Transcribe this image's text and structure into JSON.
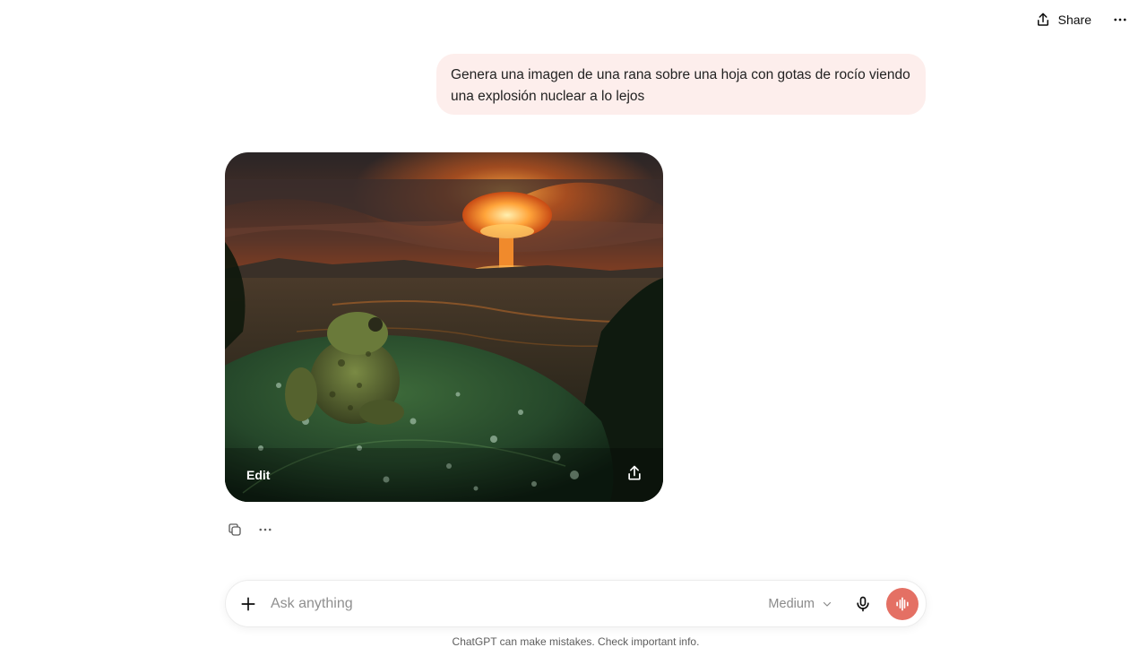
{
  "header": {
    "share_label": "Share",
    "share_icon": "share-icon",
    "more_icon": "more-icon"
  },
  "conversation": {
    "user_message": "Genera una imagen de una rana sobre una hoja con gotas de rocío viendo una explosión nuclear a lo lejos",
    "image": {
      "edit_label": "Edit",
      "share_icon": "share-icon"
    },
    "actions": {
      "copy_icon": "copy-icon",
      "more_icon": "more-icon"
    }
  },
  "composer": {
    "placeholder": "Ask anything",
    "model_label": "Medium",
    "plus_icon": "plus-icon",
    "mic_icon": "microphone-icon",
    "voice_icon": "voice-mode-icon",
    "voice_color": "#e47064"
  },
  "footer": {
    "disclaimer": "ChatGPT can make mistakes. Check important info."
  },
  "colors": {
    "user_bubble": "#fdeeec",
    "accent": "#e47064"
  }
}
